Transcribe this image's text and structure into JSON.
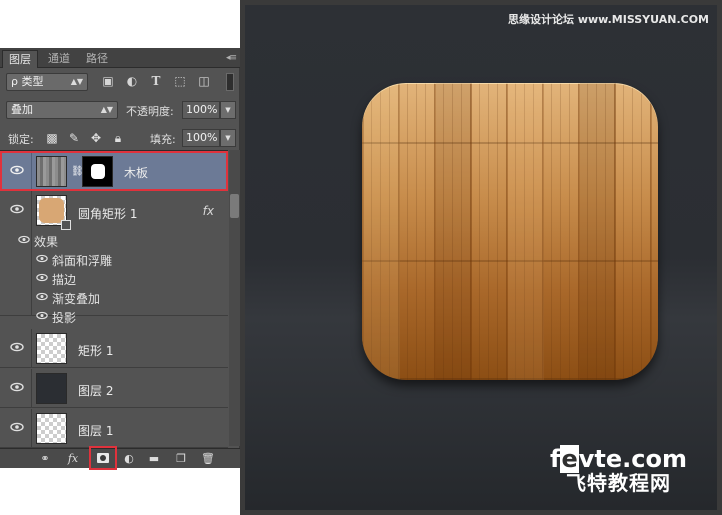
{
  "panel": {
    "tabs": [
      {
        "label": "图层",
        "active": true
      },
      {
        "label": "通道",
        "active": false
      },
      {
        "label": "路径",
        "active": false
      }
    ],
    "filter": {
      "kind_label": "ρ 类型"
    },
    "blend": {
      "mode": "叠加",
      "opacity_label": "不透明度:",
      "opacity": "100%"
    },
    "lock": {
      "label": "锁定:",
      "fill_label": "填充:",
      "fill": "100%"
    },
    "layers": [
      {
        "name": "木板",
        "selected": true,
        "has_mask": true,
        "thumb": "wood"
      },
      {
        "name": "圆角矩形 1",
        "fx": "fx",
        "thumb": "shape"
      },
      {
        "name": "矩形 1",
        "thumb": "checker"
      },
      {
        "name": "图层 2",
        "thumb": "dark"
      },
      {
        "name": "图层 1",
        "thumb": "checker"
      }
    ],
    "effects_header": "效果",
    "effects": [
      "斜面和浮雕",
      "描边",
      "渐变叠加",
      "投影"
    ],
    "bottom_icons": [
      "link-icon",
      "fx-icon",
      "add-mask-icon",
      "adjustment-icon",
      "folder-icon",
      "new-layer-icon",
      "trash-icon"
    ],
    "bottom_fx": "fx",
    "highlight_color": "#e0323c"
  },
  "canvas": {
    "watermark": "思缘设计论坛 www.MISSYUAN.COM",
    "brand_top_pre": "f",
    "brand_top_e": "e",
    "brand_top_post": "vte.com",
    "brand_bottom": "飞特教程网"
  }
}
